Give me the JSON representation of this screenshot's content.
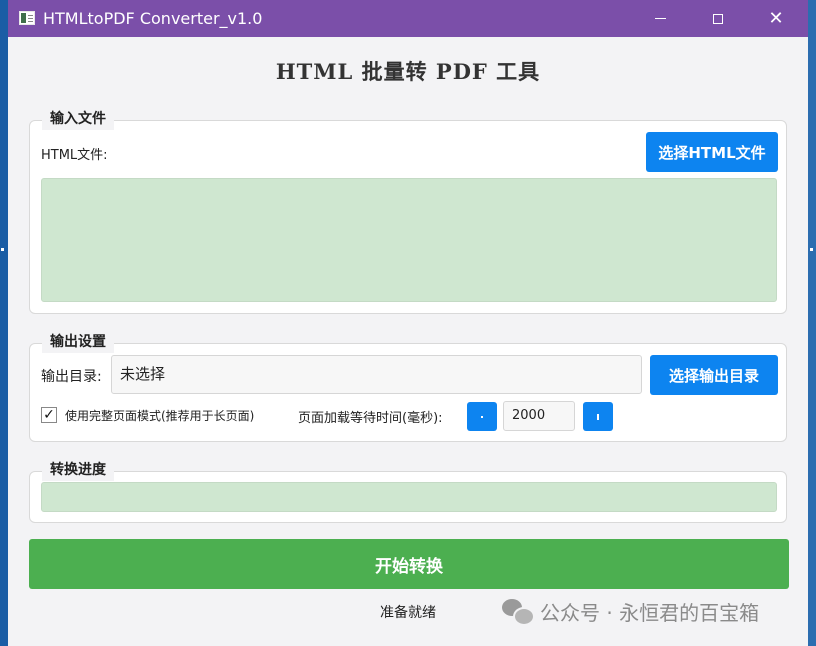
{
  "window": {
    "title": "HTMLtoPDF Converter_v1.0",
    "controls": [
      "minimize-icon",
      "maximize-icon",
      "close-icon"
    ]
  },
  "heading": "HTML 批量转 PDF 工具",
  "input_group": {
    "legend": "输入文件",
    "html_label": "HTML文件:",
    "select_button": "选择HTML文件",
    "file_list": []
  },
  "output_group": {
    "legend": "输出设置",
    "dir_label": "输出目录:",
    "dir_value": "未选择",
    "select_dir_button": "选择输出目录",
    "full_page_checked": true,
    "full_page_label": "使用完整页面模式(推荐用于长页面)",
    "wait_label": "页面加载等待时间(毫秒):",
    "wait_value": "2000"
  },
  "progress_group": {
    "legend": "转换进度",
    "progress": 0
  },
  "start_button": "开始转换",
  "status": "准备就绪",
  "watermark": "公众号 · 永恒君的百宝箱",
  "colors": {
    "titlebar": "#7b4fa9",
    "accent_blue": "#0d84f0",
    "start_green": "#4caf50",
    "list_green": "#cfe7d0",
    "window_bg": "#f3f3f5"
  }
}
